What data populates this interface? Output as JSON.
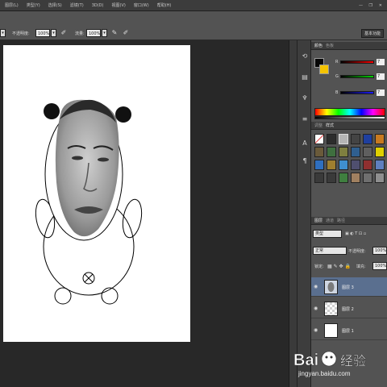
{
  "menubar": {
    "items": [
      "图层(L)",
      "类型(Y)",
      "选择(S)",
      "滤镜(T)",
      "3D(D)",
      "视图(V)",
      "窗口(W)",
      "帮助(H)"
    ]
  },
  "options": {
    "opacity_label": "不透明度:",
    "opacity_value": "100%",
    "flow_label": "流量:",
    "flow_value": "100%",
    "workspace": "基本功能"
  },
  "color_panel": {
    "tabs": [
      "颜色",
      "色板"
    ],
    "channels": [
      {
        "label": "R",
        "value": "7"
      },
      {
        "label": "G",
        "value": "7"
      },
      {
        "label": "B",
        "value": "7"
      }
    ]
  },
  "styles_panel": {
    "tabs": [
      "调整",
      "样式"
    ]
  },
  "layers_panel": {
    "tabs": [
      "图层",
      "通道",
      "路径"
    ],
    "kind_label": "类型",
    "blend_mode": "正常",
    "opacity_label": "不透明度:",
    "opacity_value": "100%",
    "lock_label": "锁定:",
    "fill_label": "填充:",
    "fill_value": "100%",
    "layers": [
      {
        "name": "图层 3",
        "selected": true
      },
      {
        "name": "图层 2",
        "selected": false
      },
      {
        "name": "图层 1",
        "selected": false
      }
    ]
  },
  "watermark": {
    "brand": "Bai",
    "brand2": "经验",
    "url": "jingyan.baidu.com"
  },
  "colors": {
    "accent": "#5a6f8f",
    "foreground": "#070707",
    "background_swatch": "#f5c400"
  }
}
